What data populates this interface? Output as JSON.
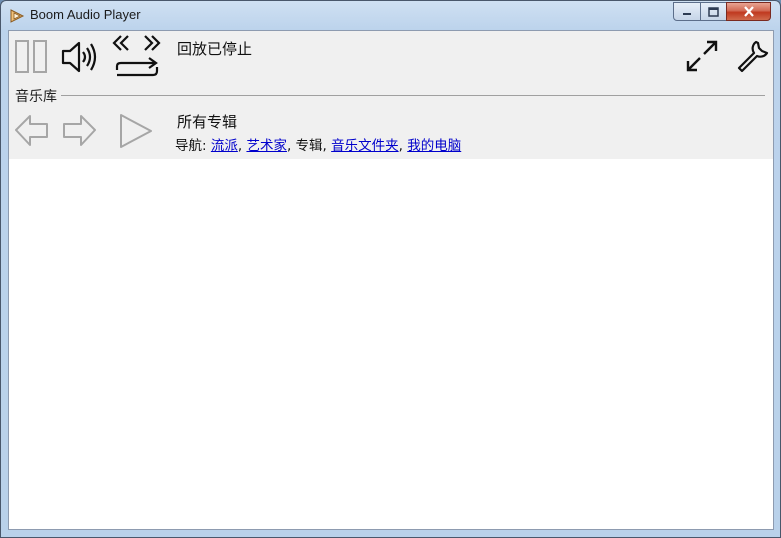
{
  "window": {
    "title": "Boom Audio Player"
  },
  "toolbar": {
    "status": "回放已停止",
    "icons": [
      "pause-icon",
      "volume-icon",
      "skip-repeat-icon",
      "fullscreen-icon",
      "settings-wrench-icon"
    ]
  },
  "library": {
    "section_label": "音乐库",
    "album_title": "所有专辑",
    "nav_prefix": "导航:",
    "nav_links": [
      "流派",
      "艺术家",
      "专辑",
      "音乐文件夹",
      "我的电脑"
    ],
    "nav_current": "专辑",
    "nav_icons": [
      "back-arrow-icon",
      "forward-arrow-icon",
      "play-icon"
    ]
  },
  "colors": {
    "link": "#0000cc",
    "toolbar_bg": "#f0f0f0",
    "icon_gray": "#a6a6a6"
  }
}
